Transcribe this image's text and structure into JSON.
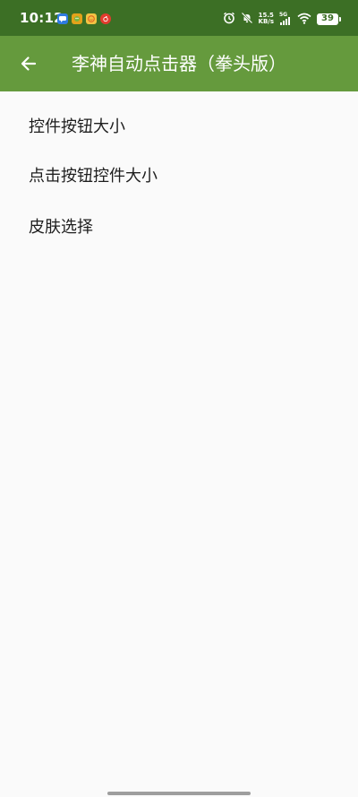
{
  "status_bar": {
    "time": "10:12",
    "network_speed_value": "15.5",
    "network_speed_unit": "KB/s",
    "network_type": "5G",
    "battery_level": "39"
  },
  "app_bar": {
    "title": "李神自动点击器（拳头版）",
    "back_icon": "arrow-left-icon"
  },
  "menu": {
    "items": [
      {
        "label": "控件按钮大小"
      },
      {
        "label": "点击按钮控件大小"
      },
      {
        "label": "皮肤选择"
      }
    ]
  },
  "colors": {
    "status_bar_bg": "#3c6f25",
    "app_bar_bg": "#659a3d",
    "page_bg": "#fafafa",
    "text_primary": "#1e1e1e"
  }
}
